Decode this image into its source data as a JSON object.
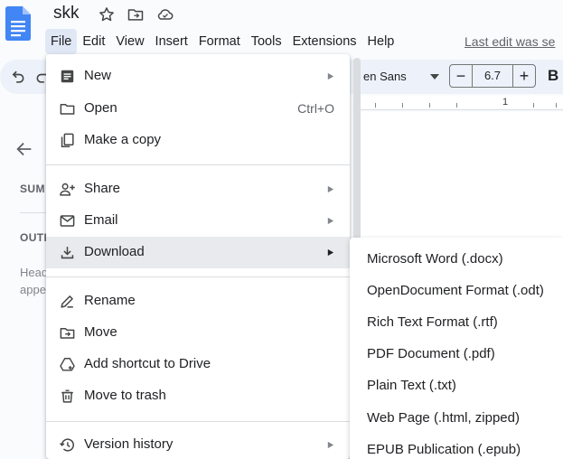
{
  "document": {
    "title": "skk"
  },
  "menubar": {
    "items": [
      "File",
      "Edit",
      "View",
      "Insert",
      "Format",
      "Tools",
      "Extensions",
      "Help"
    ],
    "active": "File",
    "last_edit": "Last edit was se"
  },
  "toolbar": {
    "font_name": "en Sans",
    "font_size": "6.7",
    "minus_label": "−",
    "plus_label": "+",
    "bold_label": "B"
  },
  "ruler": {
    "tick_label": "1"
  },
  "outline_panel": {
    "summary_label": "SUM",
    "outline_label": "OUTL",
    "hint_line1": "Head",
    "hint_line2": "appe"
  },
  "file_menu": {
    "new": "New",
    "open": "Open",
    "open_shortcut": "Ctrl+O",
    "make_copy": "Make a copy",
    "share": "Share",
    "email": "Email",
    "download": "Download",
    "rename": "Rename",
    "move": "Move",
    "add_shortcut": "Add shortcut to Drive",
    "move_to_trash": "Move to trash",
    "version_history": "Version history"
  },
  "download_submenu": {
    "items": [
      "Microsoft Word (.docx)",
      "OpenDocument Format (.odt)",
      "Rich Text Format (.rtf)",
      "PDF Document (.pdf)",
      "Plain Text (.txt)",
      "Web Page (.html, zipped)",
      "EPUB Publication (.epub)"
    ]
  },
  "colors": {
    "docs_blue": "#4285f4",
    "menu_highlight": "#e8eaed",
    "active_menu": "#e1e8f5",
    "toolbar_bg": "#edf2fa"
  },
  "icons": [
    "docs-logo-icon",
    "star-icon",
    "move-folder-icon",
    "cloud-status-icon",
    "undo-icon",
    "redo-icon",
    "back-arrow-icon",
    "document-icon",
    "folder-icon",
    "copy-icon",
    "share-person-icon",
    "email-icon",
    "download-icon",
    "rename-icon",
    "move-icon",
    "drive-shortcut-icon",
    "trash-icon",
    "history-icon",
    "submenu-arrow-icon"
  ]
}
